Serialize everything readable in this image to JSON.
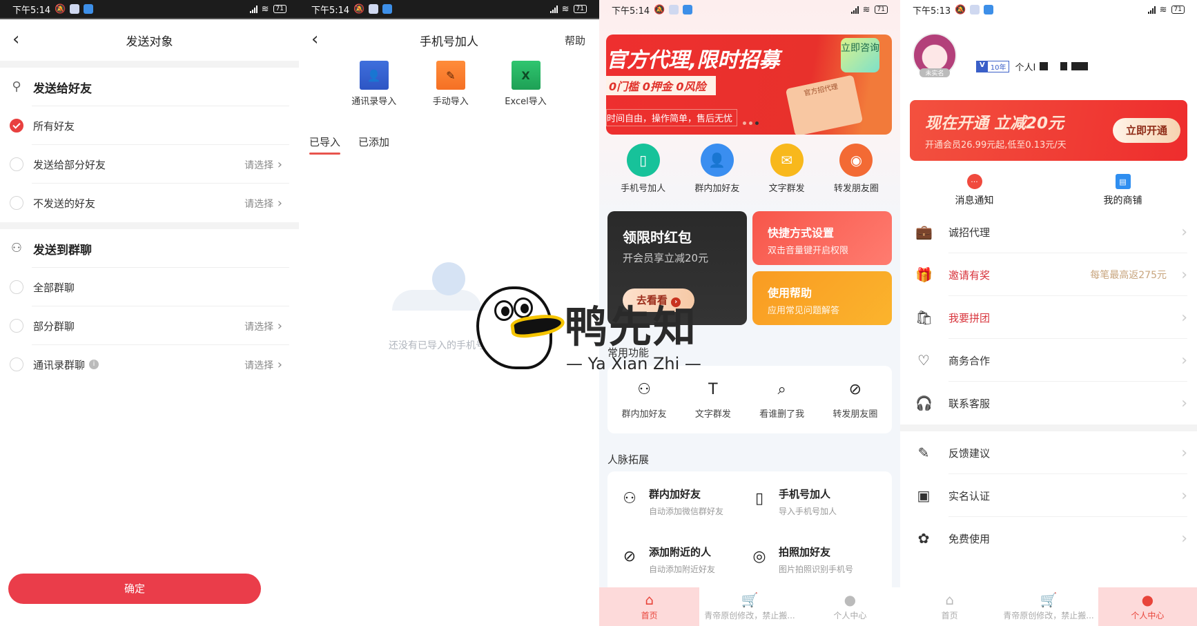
{
  "status": {
    "p1": {
      "time": "下午5:14",
      "battery": "71"
    },
    "p2": {
      "time": "下午5:14",
      "battery": "71"
    },
    "p3": {
      "time": "下午5:14",
      "battery": "71"
    },
    "p4": {
      "time": "下午5:13",
      "battery": "71"
    }
  },
  "send_target": {
    "title": "发送对象",
    "friends_section": "发送给好友",
    "friend_options": [
      {
        "label": "所有好友",
        "selected": true,
        "select_text": ""
      },
      {
        "label": "发送给部分好友",
        "selected": false,
        "select_text": "请选择"
      },
      {
        "label": "不发送的好友",
        "selected": false,
        "select_text": "请选择"
      }
    ],
    "groups_section": "发送到群聊",
    "group_options": [
      {
        "label": "全部群聊",
        "selected": false,
        "select_text": ""
      },
      {
        "label": "部分群聊",
        "selected": false,
        "select_text": "请选择"
      },
      {
        "label": "通讯录群聊",
        "selected": false,
        "select_text": "请选择",
        "info": "i"
      }
    ],
    "confirm": "确定"
  },
  "phone_add": {
    "title": "手机号加人",
    "help": "帮助",
    "imports": [
      {
        "label": "通讯录导入",
        "icon": "contacts-book-icon",
        "glyph": "👤"
      },
      {
        "label": "手动导入",
        "icon": "pencil-icon",
        "glyph": "✎"
      },
      {
        "label": "Excel导入",
        "icon": "excel-icon",
        "glyph": "X"
      }
    ],
    "tabs": [
      {
        "label": "已导入",
        "active": true
      },
      {
        "label": "已添加",
        "active": false
      }
    ],
    "empty_text": "还没有已导入的手机号"
  },
  "home": {
    "banner": {
      "title": "官方代理,限时招募",
      "tags": "0门槛   0押金   0风险",
      "sub": "时间自由，操作简单，售后无忧",
      "consult": "立即咨询",
      "gift_label": "官方招代理",
      "slides": 3,
      "active_slide": 3
    },
    "quick": [
      {
        "label": "手机号加人",
        "color": "#17c29a",
        "glyph": "▯"
      },
      {
        "label": "群内加好友",
        "color": "#3a8ef0",
        "glyph": "👤"
      },
      {
        "label": "文字群发",
        "color": "#f8b81c",
        "glyph": "✉"
      },
      {
        "label": "转发朋友圈",
        "color": "#f36a34",
        "glyph": "◉"
      }
    ],
    "red_packet": {
      "title": "领限时红包",
      "sub": "开会员享立减20元",
      "button": "去看看"
    },
    "shortcut_card": {
      "title": "快捷方式设置",
      "sub": "双击音量键开启权限"
    },
    "help_card": {
      "title": "使用帮助",
      "sub": "应用常见问题解答"
    },
    "common_title": "常用功能",
    "common": [
      {
        "label": "群内加好友",
        "glyph": "⚇"
      },
      {
        "label": "文字群发",
        "glyph": "T"
      },
      {
        "label": "看谁删了我",
        "glyph": "⌕"
      },
      {
        "label": "转发朋友圈",
        "glyph": "⊘"
      }
    ],
    "network_title": "人脉拓展",
    "network": [
      {
        "title": "群内加好友",
        "sub": "自动添加微信群好友",
        "glyph": "⚇"
      },
      {
        "title": "手机号加人",
        "sub": "导入手机号加人",
        "glyph": "▯"
      },
      {
        "title": "添加附近的人",
        "sub": "自动添加附近好友",
        "glyph": "⊘"
      },
      {
        "title": "拍照加好友",
        "sub": "图片拍照识别手机号",
        "glyph": "◎"
      }
    ]
  },
  "tabbar": [
    {
      "label": "首页",
      "glyph": "⌂"
    },
    {
      "label": "青帝原创修改，禁止搬...",
      "glyph": "🛒"
    },
    {
      "label": "个人中心",
      "glyph": "●"
    }
  ],
  "profile": {
    "avatar_badge": "未实名",
    "vip_tag": "V",
    "vip_years": "10年",
    "name_prefix": "个人I",
    "vip_banner": {
      "title": "现在开通  立减20元",
      "sub": "开通会员26.99元起,低至0.13元/天",
      "button": "立即开通"
    },
    "shortcuts": [
      {
        "label": "消息通知",
        "color": "#f04a3e",
        "glyph": "···"
      },
      {
        "label": "我的商铺",
        "color": "#2f8ef0",
        "glyph": "▤"
      }
    ],
    "menu_group1": [
      {
        "label": "诚招代理",
        "glyph": "💼",
        "red": false,
        "extra": ""
      },
      {
        "label": "邀请有奖",
        "glyph": "🎁",
        "red": true,
        "extra": "每笔最高返275元"
      },
      {
        "label": "我要拼团",
        "glyph": "🛍",
        "red": true,
        "extra": ""
      },
      {
        "label": "商务合作",
        "glyph": "♡",
        "red": false,
        "extra": ""
      },
      {
        "label": "联系客服",
        "glyph": "🎧",
        "red": false,
        "extra": ""
      }
    ],
    "menu_group2": [
      {
        "label": "反馈建议",
        "glyph": "✎",
        "red": false,
        "extra": ""
      },
      {
        "label": "实名认证",
        "glyph": "▣",
        "red": false,
        "extra": ""
      },
      {
        "label": "免费使用",
        "glyph": "✿",
        "red": false,
        "extra": ""
      }
    ]
  },
  "watermark": {
    "cn": "鸭先知",
    "en": "— Ya Xian Zhi —"
  },
  "colors": {
    "accent": "#e8403f",
    "confirm": "#ea3d4a",
    "gold": "#c8a57e"
  }
}
